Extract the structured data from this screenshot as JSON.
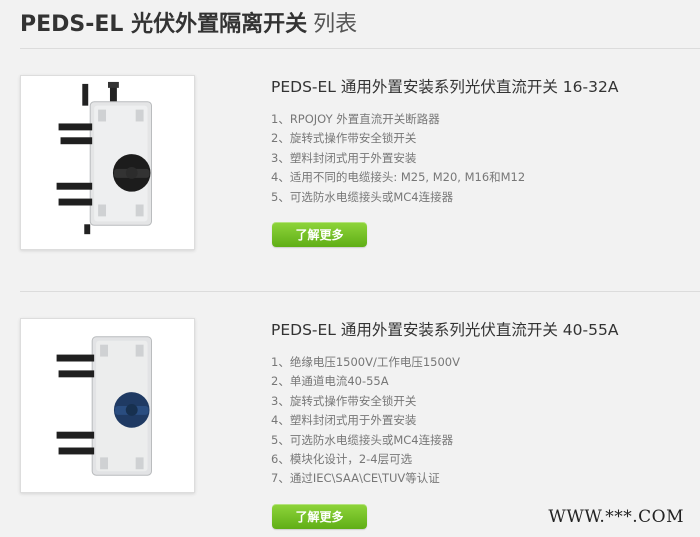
{
  "page": {
    "title_bold": "PEDS-EL 光伏外置隔离开关",
    "title_light": "列表"
  },
  "products": [
    {
      "title": "PEDS-EL 通用外置安装系列光伏直流开关 16-32A",
      "features": [
        "1、RPOJOY 外置直流开关断路器",
        "2、旋转式操作带安全锁开关",
        "3、塑料封闭式用于外置安装",
        "4、适用不同的电缆接头: M25, M20, M16和M12",
        "5、可选防水电缆接头或MC4连接器"
      ],
      "button": "了解更多",
      "handle_color": "#1c1c1c"
    },
    {
      "title": "PEDS-EL 通用外置安装系列光伏直流开关 40-55A",
      "features": [
        "1、绝缘电压1500V/工作电压1500V",
        "2、单通道电流40-55A",
        "3、旋转式操作带安全锁开关",
        "4、塑料封闭式用于外置安装",
        "5、可选防水电缆接头或MC4连接器",
        "6、模块化设计，2-4层可选",
        "7、通过IEC\\SAA\\CE\\TUV等认证"
      ],
      "button": "了解更多",
      "handle_color": "#1f3a63"
    }
  ],
  "watermark": "WWW.***.COM",
  "colors": {
    "button_top": "#8fd53b",
    "button_bottom": "#5fae16",
    "background": "#f2f2f2"
  }
}
